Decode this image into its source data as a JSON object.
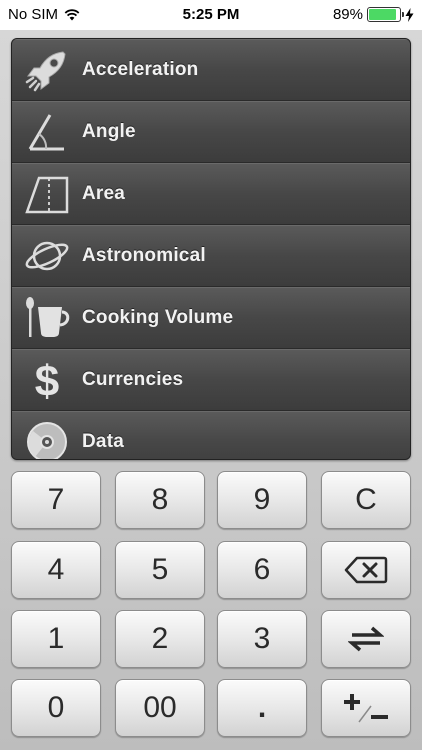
{
  "status_bar": {
    "carrier": "No SIM",
    "time": "5:25 PM",
    "battery": "89%",
    "battery_level": 0.89,
    "battery_color": "#4cd964"
  },
  "categories": [
    {
      "label": "Acceleration",
      "icon": "rocket-icon"
    },
    {
      "label": "Angle",
      "icon": "angle-icon"
    },
    {
      "label": "Area",
      "icon": "area-icon"
    },
    {
      "label": "Astronomical",
      "icon": "planet-icon"
    },
    {
      "label": "Cooking Volume",
      "icon": "cup-spoon-icon"
    },
    {
      "label": "Currencies",
      "icon": "dollar-icon"
    },
    {
      "label": "Data",
      "icon": "disc-icon"
    }
  ],
  "keypad": {
    "rows": [
      [
        "7",
        "8",
        "9",
        "C"
      ],
      [
        "4",
        "5",
        "6",
        "backspace"
      ],
      [
        "1",
        "2",
        "3",
        "swap"
      ],
      [
        "0",
        "00",
        ".",
        "plus-minus"
      ]
    ],
    "labels": {
      "k7": "7",
      "k8": "8",
      "k9": "9",
      "clear": "C",
      "k4": "4",
      "k5": "5",
      "k6": "6",
      "k1": "1",
      "k2": "2",
      "k3": "3",
      "k0": "0",
      "k00": "00",
      "decimal": "."
    }
  }
}
